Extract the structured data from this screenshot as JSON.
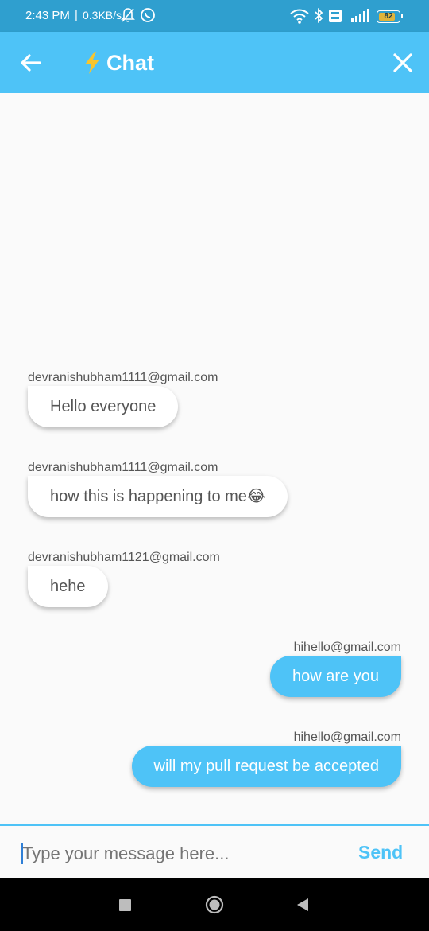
{
  "status_bar": {
    "time": "2:43 PM",
    "speed": "0.3KB/s",
    "battery": "82",
    "battery_level": 0.82
  },
  "app_bar": {
    "title": "Chat",
    "back_icon": "arrow-left-icon",
    "title_icon": "lightning-bolt-icon",
    "close_icon": "close-icon",
    "background": "#4ec3f7"
  },
  "messages": [
    {
      "sender": "devranishubham1111@gmail.com",
      "text": "Hello everyone",
      "side": "left"
    },
    {
      "sender": "devranishubham1111@gmail.com",
      "text": "how this is happening to me😂",
      "side": "left"
    },
    {
      "sender": "devranishubham1121@gmail.com",
      "text": "hehe",
      "side": "left"
    },
    {
      "sender": "hihello@gmail.com",
      "text": "how are you",
      "side": "right"
    },
    {
      "sender": "hihello@gmail.com",
      "text": "will my pull request be accepted",
      "side": "right"
    }
  ],
  "composer": {
    "placeholder": "Type your message here...",
    "value": "",
    "send_label": "Send"
  },
  "colors": {
    "accent": "#4ec3f7",
    "status_bar": "#2f9fcf",
    "left_bubble": "#ffffff",
    "right_bubble": "#4ec3f7"
  },
  "nav_bar": {
    "recents_icon": "square-icon",
    "home_icon": "circle-home-icon",
    "back_icon": "triangle-back-icon"
  }
}
